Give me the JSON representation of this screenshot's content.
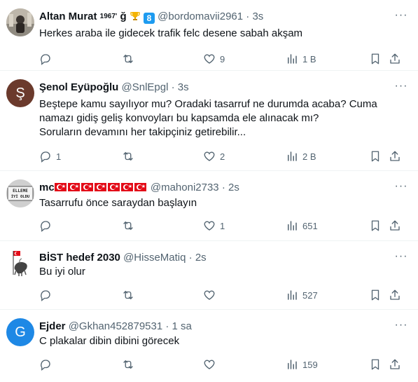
{
  "tweets": [
    {
      "name": "Altan Murat",
      "name_suffix": "1967'",
      "name_extra": "ğ",
      "badge": "8",
      "handle": "@bordomavii2961",
      "dot": "·",
      "time": "3s",
      "text": [
        "Herkes araba ile gidecek trafik felc desene sabah akşam"
      ],
      "likes": "9",
      "views": "1 B",
      "replies": "",
      "retweets": ""
    },
    {
      "name": "Şenol Eyüpoğlu",
      "avatar_letter": "Ş",
      "avatar_color": "#6b3a2c",
      "handle": "@SnlEpgl",
      "dot": "·",
      "time": "3s",
      "text": [
        "Beştepe kamu sayılıyor mu? Oradaki tasarruf ne durumda acaba? Cuma",
        "namazı gidiş geliş konvoyları bu kapsamda ele alınacak mı?",
        "Soruların devamını her takipçiniz getirebilir..."
      ],
      "replies": "1",
      "likes": "2",
      "views": "2 B",
      "retweets": ""
    },
    {
      "name": "mc",
      "handle": "@mahoni2733",
      "dot": "·",
      "time": "2s",
      "avatar_text_top": "ELLEME",
      "avatar_text_bottom": "İYİ OLDU",
      "text": [
        "Tasarrufu önce saraydan başlayın"
      ],
      "likes": "1",
      "views": "651",
      "replies": "",
      "retweets": ""
    },
    {
      "name": "BİST hedef 2030",
      "handle": "@HisseMatiq",
      "dot": "·",
      "time": "2s",
      "text": [
        "Bu iyi olur"
      ],
      "views": "527",
      "likes": "",
      "replies": "",
      "retweets": ""
    },
    {
      "name": "Ejder",
      "avatar_letter": "G",
      "avatar_color": "#1e88e5",
      "handle": "@Gkhan452879531",
      "dot": "·",
      "time": "1 sa",
      "text": [
        "C plakalar dibin dibini görecek"
      ],
      "views": "159",
      "likes": "",
      "replies": "",
      "retweets": ""
    }
  ],
  "icons": {
    "more": "more-icon",
    "reply": "reply-icon",
    "retweet": "retweet-icon",
    "like": "heart-icon",
    "views": "views-icon",
    "bookmark": "bookmark-icon",
    "share": "share-icon"
  },
  "more_glyph": "···"
}
